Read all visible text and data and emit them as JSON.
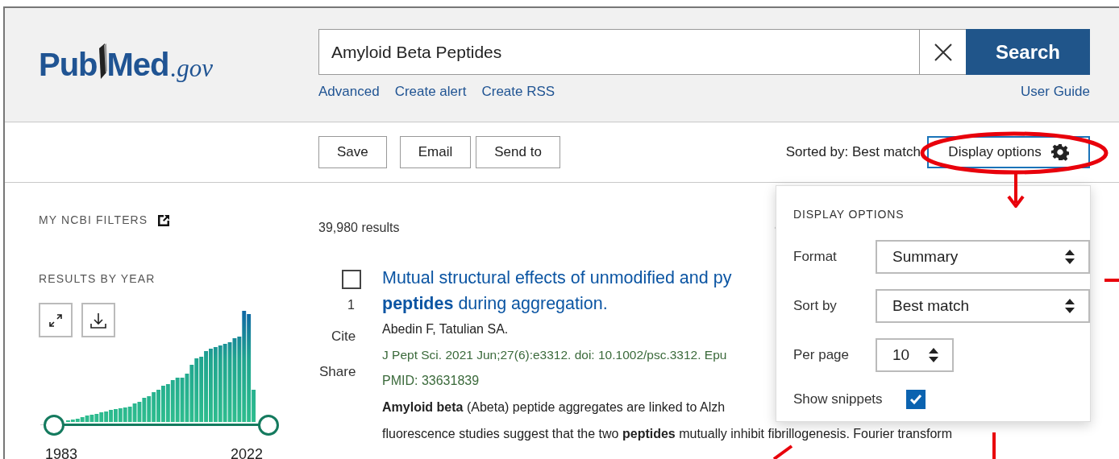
{
  "header": {
    "logo": {
      "parts": [
        "Pub",
        "Med"
      ],
      "domain": ".gov"
    },
    "search": {
      "value": "Amyloid Beta Peptides",
      "button": "Search"
    },
    "links": [
      "Advanced",
      "Create alert",
      "Create RSS"
    ],
    "user_guide": "User Guide"
  },
  "toolbar": {
    "actions": [
      "Save",
      "Email",
      "Send to"
    ],
    "sorted_by": "Sorted by: Best match",
    "display_options": {
      "label": "Display options",
      "expanded": true
    }
  },
  "sidebar": {
    "filters_heading": "MY NCBI FILTERS",
    "results_by_year": "RESULTS BY YEAR",
    "year_start": "1983",
    "year_end": "2022"
  },
  "results": {
    "count": "39,980 results",
    "items": [
      {
        "number": "1",
        "selected": false,
        "actions": [
          "Cite",
          "Share"
        ],
        "title_line_1": "Mutual structural effects of unmodified and py",
        "title_line_2": "**peptides** during aggregation.",
        "authors": "Abedin F, Tatulian SA.",
        "citation": "J Pept Sci. 2021 Jun;27(6):e3312. doi: 10.1002/psc.3312. Epu",
        "pmid": "PMID: 33631839",
        "snippet": [
          "**Amyloid beta** (Abeta) peptide aggregates are linked to Alzh",
          "fluorescence studies suggest that the two **peptides** mutually inhibit fibrillogenesis. Fourier transform"
        ]
      }
    ]
  },
  "display_options_panel": {
    "heading": "DISPLAY OPTIONS",
    "fields": [
      {
        "kind": "select",
        "label": "Format",
        "value": "Summary"
      },
      {
        "kind": "select",
        "label": "Sort by",
        "value": "Best match"
      },
      {
        "kind": "number",
        "label": "Per page",
        "value": "10"
      },
      {
        "kind": "checkbox",
        "label": "Show snippets",
        "checked": true
      }
    ]
  }
}
